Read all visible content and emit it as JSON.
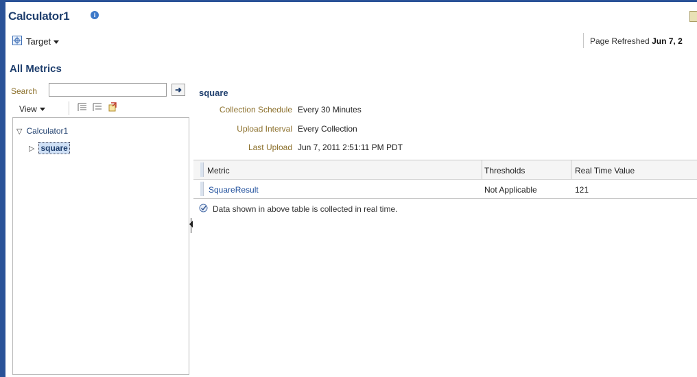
{
  "header": {
    "title": "Calculator1",
    "info_icon": "info-icon",
    "target_label": "Target",
    "refresh_label": "Page Refreshed",
    "refresh_value": "Jun 7, 2"
  },
  "section_title": "All Metrics",
  "search": {
    "label": "Search",
    "value": "",
    "placeholder": ""
  },
  "toolbar": {
    "view_label": "View"
  },
  "tree": {
    "root_label": "Calculator1",
    "child_label": "square"
  },
  "metric": {
    "title": "square",
    "props": [
      {
        "label": "Collection Schedule",
        "value": "Every 30 Minutes"
      },
      {
        "label": "Upload Interval",
        "value": "Every Collection"
      },
      {
        "label": "Last Upload",
        "value": "Jun 7, 2011 2:51:11 PM PDT"
      }
    ]
  },
  "table": {
    "columns": [
      "Metric",
      "Thresholds",
      "Real Time Value"
    ],
    "rows": [
      [
        "SquareResult",
        "Not Applicable",
        "121"
      ]
    ]
  },
  "note": "Data shown in above table is collected in real time.",
  "colors": {
    "brand_blue": "#2a5298",
    "title_blue": "#1f3f6e",
    "label_gold": "#8b6f2a",
    "link_blue": "#1f4f9c"
  }
}
